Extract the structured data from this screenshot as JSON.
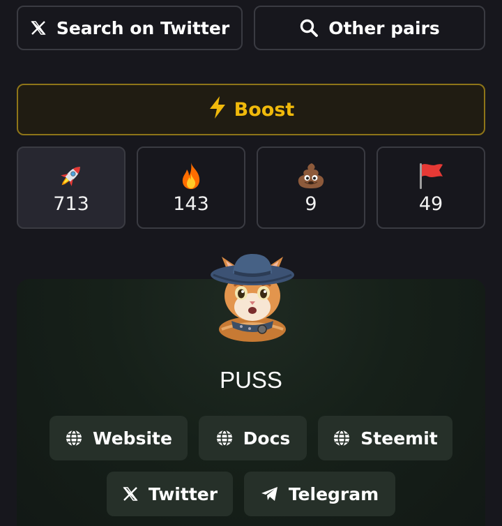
{
  "actions": {
    "search_twitter": "Search on Twitter",
    "other_pairs": "Other pairs"
  },
  "boost": {
    "label": "Boost",
    "color": "#f0b90b"
  },
  "reactions": [
    {
      "icon": "rocket-icon",
      "count": "713",
      "active": true
    },
    {
      "icon": "fire-icon",
      "count": "143",
      "active": false
    },
    {
      "icon": "poop-icon",
      "count": "9",
      "active": false
    },
    {
      "icon": "flag-icon",
      "count": "49",
      "active": false
    }
  ],
  "token": {
    "name": "PUSS",
    "links": [
      {
        "icon": "globe-icon",
        "label": "Website"
      },
      {
        "icon": "globe-icon",
        "label": "Docs"
      },
      {
        "icon": "globe-icon",
        "label": "Steemit"
      },
      {
        "icon": "x-logo-icon",
        "label": "Twitter"
      },
      {
        "icon": "telegram-icon",
        "label": "Telegram"
      }
    ]
  },
  "colors": {
    "background": "#17171d",
    "border": "#3a3b42",
    "card": "#263029",
    "accent": "#f0b90b"
  }
}
